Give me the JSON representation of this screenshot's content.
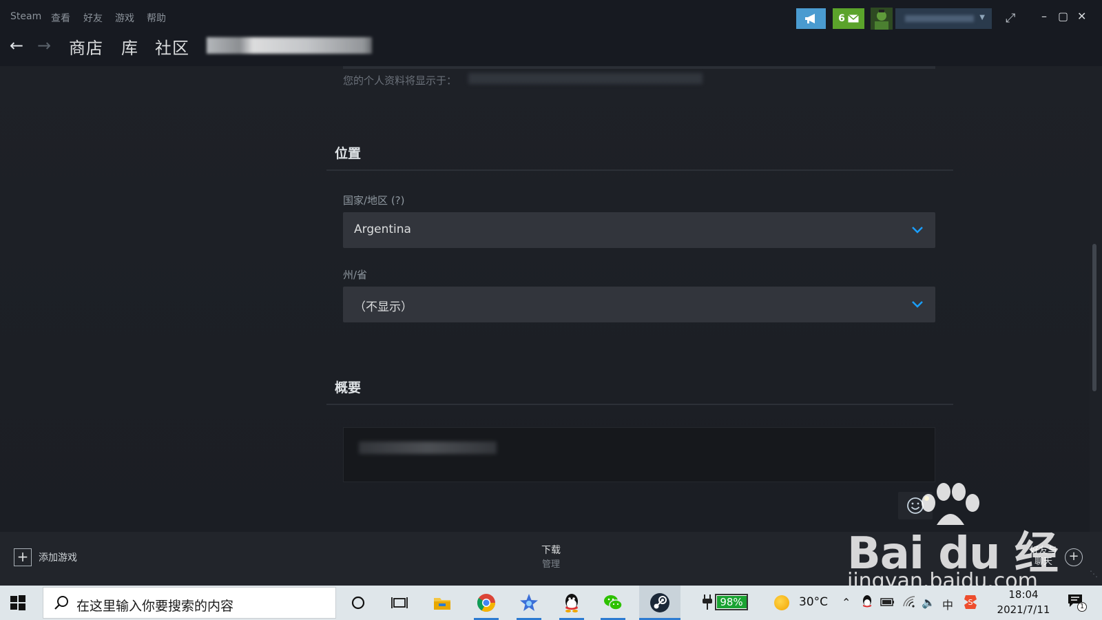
{
  "menu": {
    "items": [
      "Steam",
      "查看",
      "好友",
      "游戏",
      "帮助"
    ]
  },
  "nav": {
    "tabs": [
      "商店",
      "库",
      "社区"
    ]
  },
  "header": {
    "notifications_count": "6"
  },
  "profile": {
    "url_label": "您的个人资料将显示于："
  },
  "location": {
    "title": "位置",
    "country_label": "国家/地区 (?)",
    "country_value": "Argentina",
    "state_label": "州/省",
    "state_value": "（不显示）"
  },
  "summary": {
    "title": "概要"
  },
  "bottombar": {
    "add_game": "添加游戏",
    "downloads": "下载",
    "downloads_sub": "管理",
    "friends_line1": "好友与",
    "friends_line2": "聊天"
  },
  "watermark": {
    "brand": "Bai du 经验",
    "url": "jingyan.baidu.com"
  },
  "taskbar": {
    "search_placeholder": "在这里输入你要搜索的内容",
    "battery_percent": 98,
    "battery_label": "98%",
    "temperature": "30°C",
    "ime": "中",
    "time": "18:04",
    "date": "2021/7/11",
    "notifications": "1"
  },
  "colors": {
    "accent_blue": "#1a9fff",
    "steam_green": "#5ba32b",
    "announce_blue": "#4a9bd0",
    "battery_green": "#1aa332"
  }
}
